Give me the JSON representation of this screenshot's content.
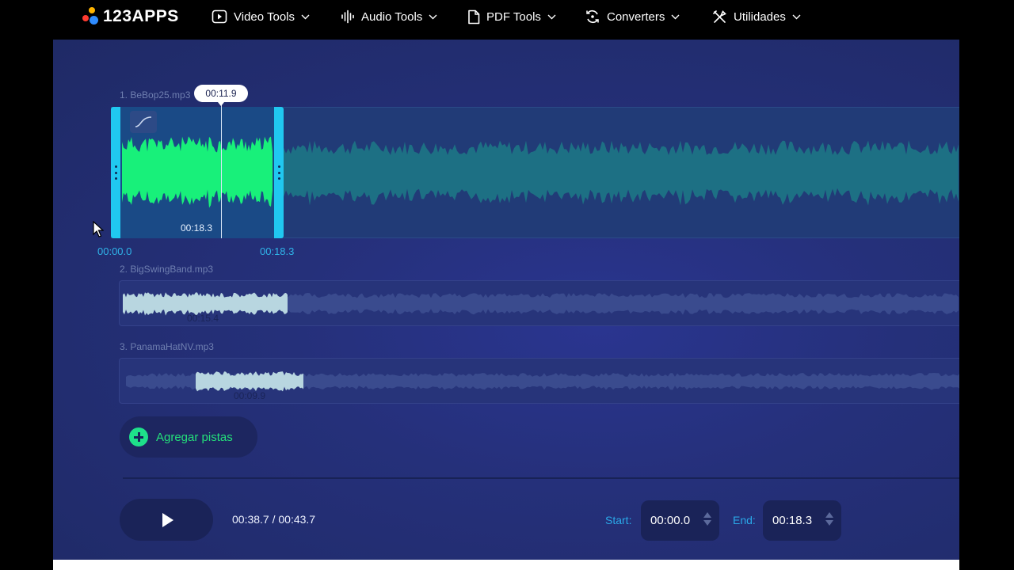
{
  "app": {
    "logo_text": "123APPS"
  },
  "nav": [
    {
      "label": "Video Tools",
      "icon": "video-icon"
    },
    {
      "label": "Audio Tools",
      "icon": "audio-wave-icon"
    },
    {
      "label": "PDF Tools",
      "icon": "pdf-icon"
    },
    {
      "label": "Converters",
      "icon": "convert-icon"
    },
    {
      "label": "Utilidades",
      "icon": "tools-icon"
    }
  ],
  "tracks": [
    {
      "label": "1. BeBop25.mp3",
      "duration": "00:18.3",
      "color": "#18f07a"
    },
    {
      "label": "2. BigSwingBand.mp3",
      "duration": "00:15.4",
      "color": "#b8d6e0"
    },
    {
      "label": "3. PanamaHatNV.mp3",
      "duration": "00:09.9",
      "color": "#b8d6e0"
    }
  ],
  "selection": {
    "cursor_time": "00:11.9",
    "ruler_start": "00:00.0",
    "ruler_end": "00:18.3"
  },
  "add_tracks": {
    "label": "Agregar pistas"
  },
  "player": {
    "time": "00:38.7 / 00:43.7",
    "start_label": "Start:",
    "start_value": "00:00.0",
    "end_label": "End:",
    "end_value": "00:18.3"
  }
}
